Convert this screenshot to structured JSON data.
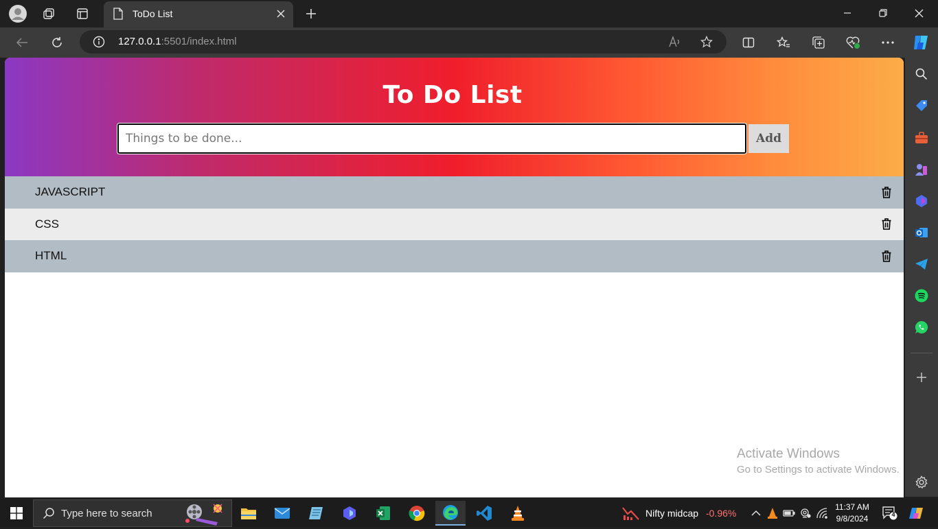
{
  "browser": {
    "tab_title": "ToDo List",
    "url_host": "127.0.0.1",
    "url_path": ":5501/index.html"
  },
  "page": {
    "title": "To Do List",
    "input_placeholder": "Things to be done...",
    "add_label": "Add",
    "todos": [
      "JAVASCRIPT",
      "CSS",
      "HTML"
    ],
    "watermark_title": "Activate Windows",
    "watermark_subtitle": "Go to Settings to activate Windows."
  },
  "taskbar": {
    "search_placeholder": "Type here to search",
    "ticker_name": "Nifty midcap",
    "ticker_change": "-0.96%",
    "time": "11:37 AM",
    "date": "9/8/2024",
    "notification_count": "4"
  },
  "colors": {
    "gradient": [
      "#8b38c4",
      "#c02a6a",
      "#f01e2c",
      "#ff5a32",
      "#fcac48"
    ],
    "row_odd": "#b2bcc4",
    "row_even": "#ececec",
    "chrome_bg": "#202020"
  }
}
